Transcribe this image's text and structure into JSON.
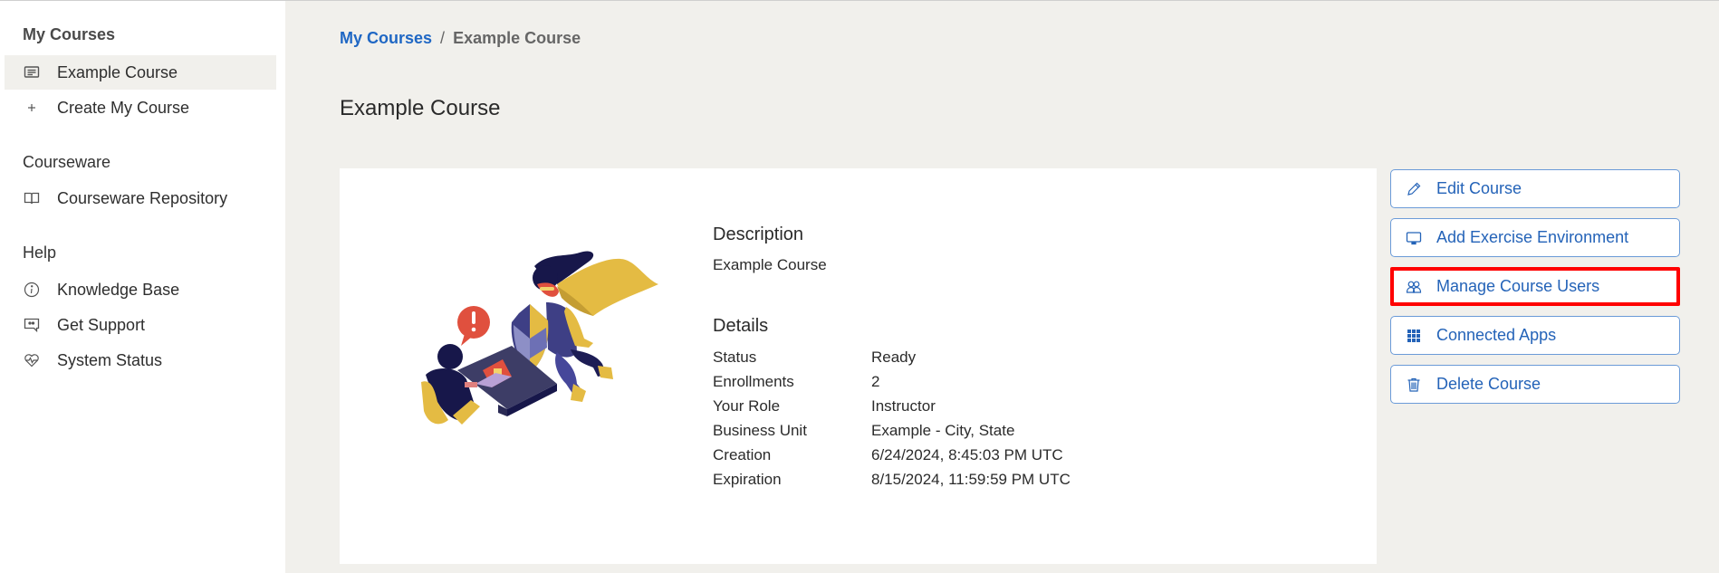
{
  "sidebar": {
    "sections": [
      {
        "heading": "My Courses",
        "items": [
          {
            "label": "Example Course",
            "icon": "course-card-icon",
            "active": true
          },
          {
            "label": "Create My Course",
            "icon": "plus-icon",
            "active": false
          }
        ]
      },
      {
        "heading": "Courseware",
        "items": [
          {
            "label": "Courseware Repository",
            "icon": "book-icon",
            "active": false
          }
        ]
      },
      {
        "heading": "Help",
        "items": [
          {
            "label": "Knowledge Base",
            "icon": "info-icon",
            "active": false
          },
          {
            "label": "Get Support",
            "icon": "quote-chat-icon",
            "active": false
          },
          {
            "label": "System Status",
            "icon": "heart-pulse-icon",
            "active": false
          }
        ]
      }
    ]
  },
  "breadcrumb": {
    "link": "My Courses",
    "separator": "/",
    "current": "Example Course"
  },
  "page_title": "Example Course",
  "course": {
    "description_title": "Description",
    "description": "Example Course",
    "details_title": "Details",
    "details": [
      {
        "label": "Status",
        "value": "Ready"
      },
      {
        "label": "Enrollments",
        "value": "2"
      },
      {
        "label": "Your Role",
        "value": "Instructor"
      },
      {
        "label": "Business Unit",
        "value": "Example - City, State"
      },
      {
        "label": "Creation",
        "value": "6/24/2024, 8:45:03 PM UTC"
      },
      {
        "label": "Expiration",
        "value": "8/15/2024, 11:59:59 PM UTC"
      }
    ]
  },
  "actions": [
    {
      "label": "Edit Course",
      "icon": "pencil-icon",
      "highlighted": false
    },
    {
      "label": "Add Exercise Environment",
      "icon": "monitor-icon",
      "highlighted": false
    },
    {
      "label": "Manage Course Users",
      "icon": "users-icon",
      "highlighted": true
    },
    {
      "label": "Connected Apps",
      "icon": "apps-grid-icon",
      "highlighted": false
    },
    {
      "label": "Delete Course",
      "icon": "trash-icon",
      "highlighted": false
    }
  ],
  "colors": {
    "link": "#1f67c4",
    "button_text": "#2463b8",
    "button_border": "#6b9bd8",
    "highlight": "#ff0000",
    "page_bg": "#f1f0ec"
  }
}
